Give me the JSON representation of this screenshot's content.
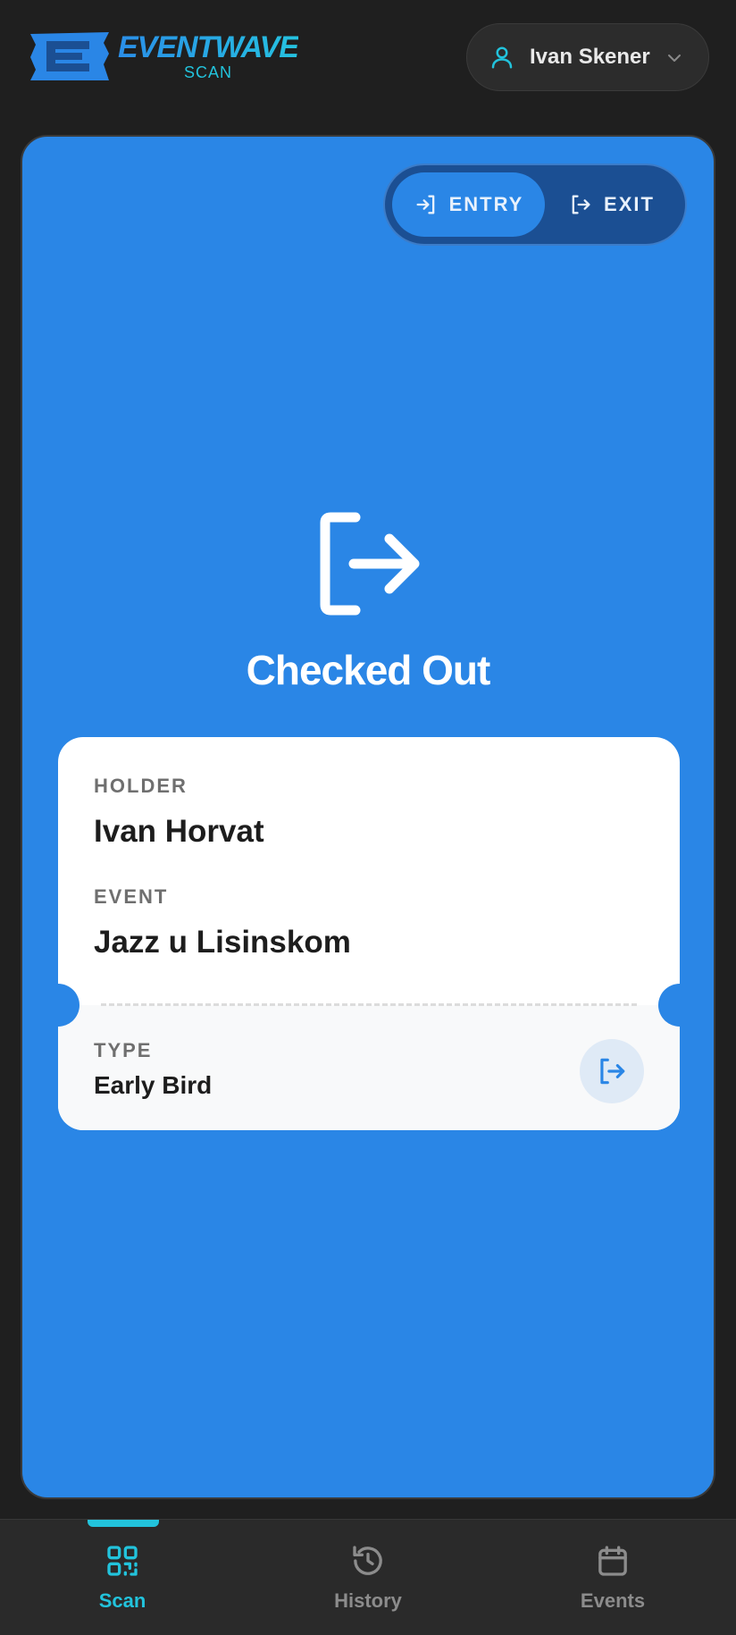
{
  "header": {
    "logo_title": "EVENTWAVE",
    "logo_subtitle": "SCAN",
    "user_name": "Ivan Skener"
  },
  "mode_toggle": {
    "entry_label": "ENTRY",
    "exit_label": "EXIT",
    "selected": "entry"
  },
  "result": {
    "status_icon": "exit-icon",
    "status_title": "Checked Out"
  },
  "ticket": {
    "holder_label": "HOLDER",
    "holder_value": "Ivan Horvat",
    "event_label": "EVENT",
    "event_value": "Jazz u Lisinskom",
    "type_label": "TYPE",
    "type_value": "Early Bird",
    "action_icon": "exit-icon"
  },
  "bottom_nav": {
    "items": [
      {
        "label": "Scan",
        "icon": "qr-code-icon",
        "active": true
      },
      {
        "label": "History",
        "icon": "history-icon",
        "active": false
      },
      {
        "label": "Events",
        "icon": "calendar-icon",
        "active": false
      }
    ]
  },
  "colors": {
    "card_bg": "#2a86e6",
    "accent_cyan": "#22c3dc",
    "page_bg": "#1f1f1f"
  }
}
